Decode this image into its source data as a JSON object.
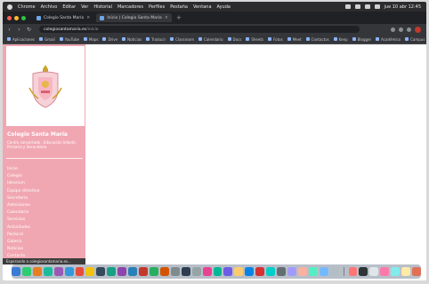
{
  "menubar": {
    "items": [
      "Chrome",
      "Archivo",
      "Editar",
      "Ver",
      "Historial",
      "Marcadores",
      "Perfiles",
      "Pestaña",
      "Ventana",
      "Ayuda"
    ],
    "clock": "jue 10 abr 12:45"
  },
  "tabs": [
    {
      "label": "Colegio Santa María"
    },
    {
      "label": "Inicio | Colegio Santa María"
    }
  ],
  "address": {
    "host": "colegiosantamaria.es",
    "path": "/inicio"
  },
  "bookmarks": [
    "Aplicaciones",
    "Gmail",
    "YouTube",
    "Maps",
    "Drive",
    "Noticias",
    "Traducir",
    "Classroom",
    "Calendario",
    "Docs",
    "Sheets",
    "Fotos",
    "Meet",
    "Contactos",
    "Keep",
    "Blogger",
    "Académico",
    "Campus"
  ],
  "sidebar": {
    "site_name": "Colegio Santa María",
    "site_sub": "Centro concertado · Educación Infantil, Primaria y Secundaria",
    "nav": [
      "Inicio",
      "Colegio",
      "Idearium",
      "Equipo directivo",
      "Secretaría",
      "Admisiones",
      "Calendario",
      "Servicios",
      "Actividades",
      "Pastoral",
      "Galería",
      "Noticias",
      "Contacto"
    ]
  },
  "status_bar": "Esperando a colegiosantamaria.es...",
  "colors": {
    "sidebar": "#f1a7b2",
    "tab_bar": "#202124",
    "menubar": "#2c2c2e"
  },
  "dock_apps": [
    "#3a7bd5",
    "#2ecc71",
    "#e67e22",
    "#1abc9c",
    "#9b59b6",
    "#3498db",
    "#e74c3c",
    "#f1c40f",
    "#34495e",
    "#16a085",
    "#8e44ad",
    "#2980b9",
    "#c0392b",
    "#27ae60",
    "#d35400",
    "#7f8c8d",
    "#2c3e50",
    "#95a5a6",
    "#e84393",
    "#00b894",
    "#6c5ce7",
    "#fdcb6e",
    "#0984e3",
    "#d63031",
    "#00cec9",
    "#636e72",
    "#a29bfe",
    "#fab1a0",
    "#55efc4",
    "#74b9ff",
    "#b2bec3",
    "#ff7675",
    "#2d3436",
    "#dfe6e9",
    "#fd79a8",
    "#81ecec",
    "#ffeaa7",
    "#e17055"
  ]
}
